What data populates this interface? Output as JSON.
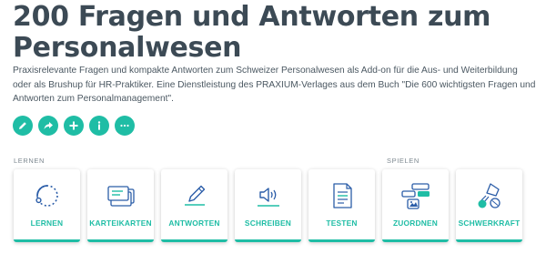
{
  "page": {
    "title": "200 Fragen und Antworten zum Personalwesen",
    "description": "Praxisrelevante Fragen und kompakte Antworten zum Schweizer Personalwesen als Add-on für die Aus- und Weiterbildung oder als Brushup für HR-Praktiker. Eine Dienstleistung des PRAXIUM-Verlages aus dem Buch \"Die 600 wichtigsten Fragen und Antworten zum Personalmanagement\"."
  },
  "actions": [
    {
      "icon": "pencil-icon"
    },
    {
      "icon": "share-icon"
    },
    {
      "icon": "plus-icon"
    },
    {
      "icon": "info-icon"
    },
    {
      "icon": "more-icon"
    }
  ],
  "sections": {
    "learn_label": "LERNEN",
    "play_label": "SPIELEN"
  },
  "modes": [
    {
      "label": "LERNEN",
      "icon": "progress-circle-icon"
    },
    {
      "label": "KARTEIKARTEN",
      "icon": "flashcards-icon"
    },
    {
      "label": "ANTWORTEN",
      "icon": "pen-icon"
    },
    {
      "label": "SCHREIBEN",
      "icon": "speaker-icon"
    },
    {
      "label": "TESTEN",
      "icon": "document-icon"
    },
    {
      "label": "ZUORDNEN",
      "icon": "match-icon"
    },
    {
      "label": "SCHWERKRAFT",
      "icon": "gravity-icon"
    }
  ],
  "colors": {
    "accent": "#1fbda5",
    "title": "#3c4a55",
    "icon": "#2b5da8"
  }
}
